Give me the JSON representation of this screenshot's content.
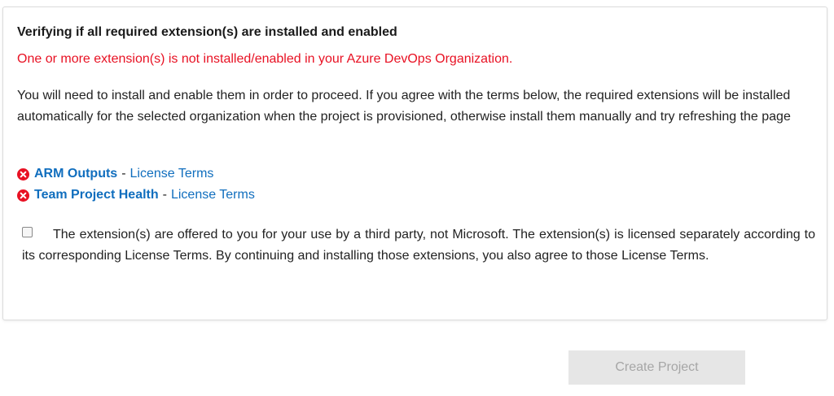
{
  "panel": {
    "heading": "Verifying if all required extension(s) are installed and enabled",
    "error_message": "One or more extension(s) is not installed/enabled in your Azure DevOps Organization.",
    "description": "You will need to install and enable them in order to proceed. If you agree with the terms below, the required extensions will be installed automatically for the selected organization when the project is provisioned, otherwise install them manually and try refreshing the page",
    "extensions": [
      {
        "name": "ARM Outputs",
        "separator": "-",
        "license_link": "License Terms",
        "status_icon": "error-x-circle-icon"
      },
      {
        "name": "Team Project Health",
        "separator": "-",
        "license_link": "License Terms",
        "status_icon": "error-x-circle-icon"
      }
    ],
    "agreement": {
      "checked": false,
      "text": "The extension(s) are offered to you for your use by a third party, not Microsoft. The extension(s) is licensed separately according to its corresponding License Terms. By continuing and installing those extensions, you also agree to those License Terms."
    }
  },
  "actions": {
    "create_project_label": "Create Project",
    "create_project_enabled": false
  },
  "colors": {
    "error": "#e81123",
    "link": "#106ebe",
    "button_disabled_bg": "#e6e6e6",
    "button_disabled_text": "#a6a6a6"
  }
}
